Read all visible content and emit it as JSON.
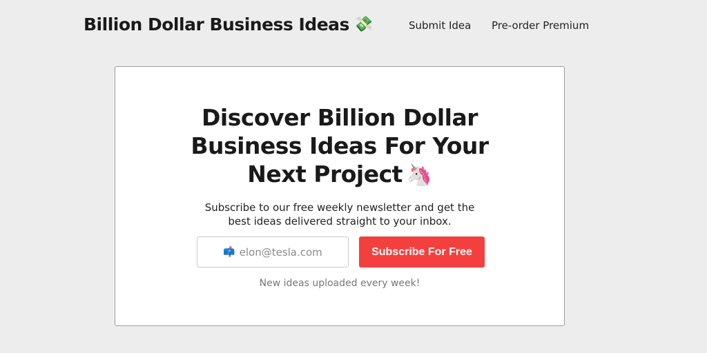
{
  "header": {
    "brand": "Billion Dollar Business Ideas",
    "brand_icon": "money-with-wings-icon",
    "brand_emoji": "💸",
    "nav": [
      {
        "label": "Submit Idea"
      },
      {
        "label": "Pre-order Premium"
      }
    ]
  },
  "hero": {
    "headline_lines": [
      "Discover Billion Dollar",
      "Business Ideas For Your",
      "Next Project"
    ],
    "headline_icon": "unicorn-icon",
    "headline_emoji": "🦄",
    "subtitle_lines": [
      "Subscribe to our free weekly newsletter and get the",
      "best ideas delivered straight to your inbox."
    ],
    "email_placeholder": "elon@tesla.com",
    "email_icon": "mailbox-icon",
    "email_emoji": "📫",
    "subscribe_label": "Subscribe For Free",
    "note": "New ideas uploaded every week!"
  },
  "colors": {
    "background": "#ededed",
    "card": "#ffffff",
    "accent": "#f43f3f"
  }
}
